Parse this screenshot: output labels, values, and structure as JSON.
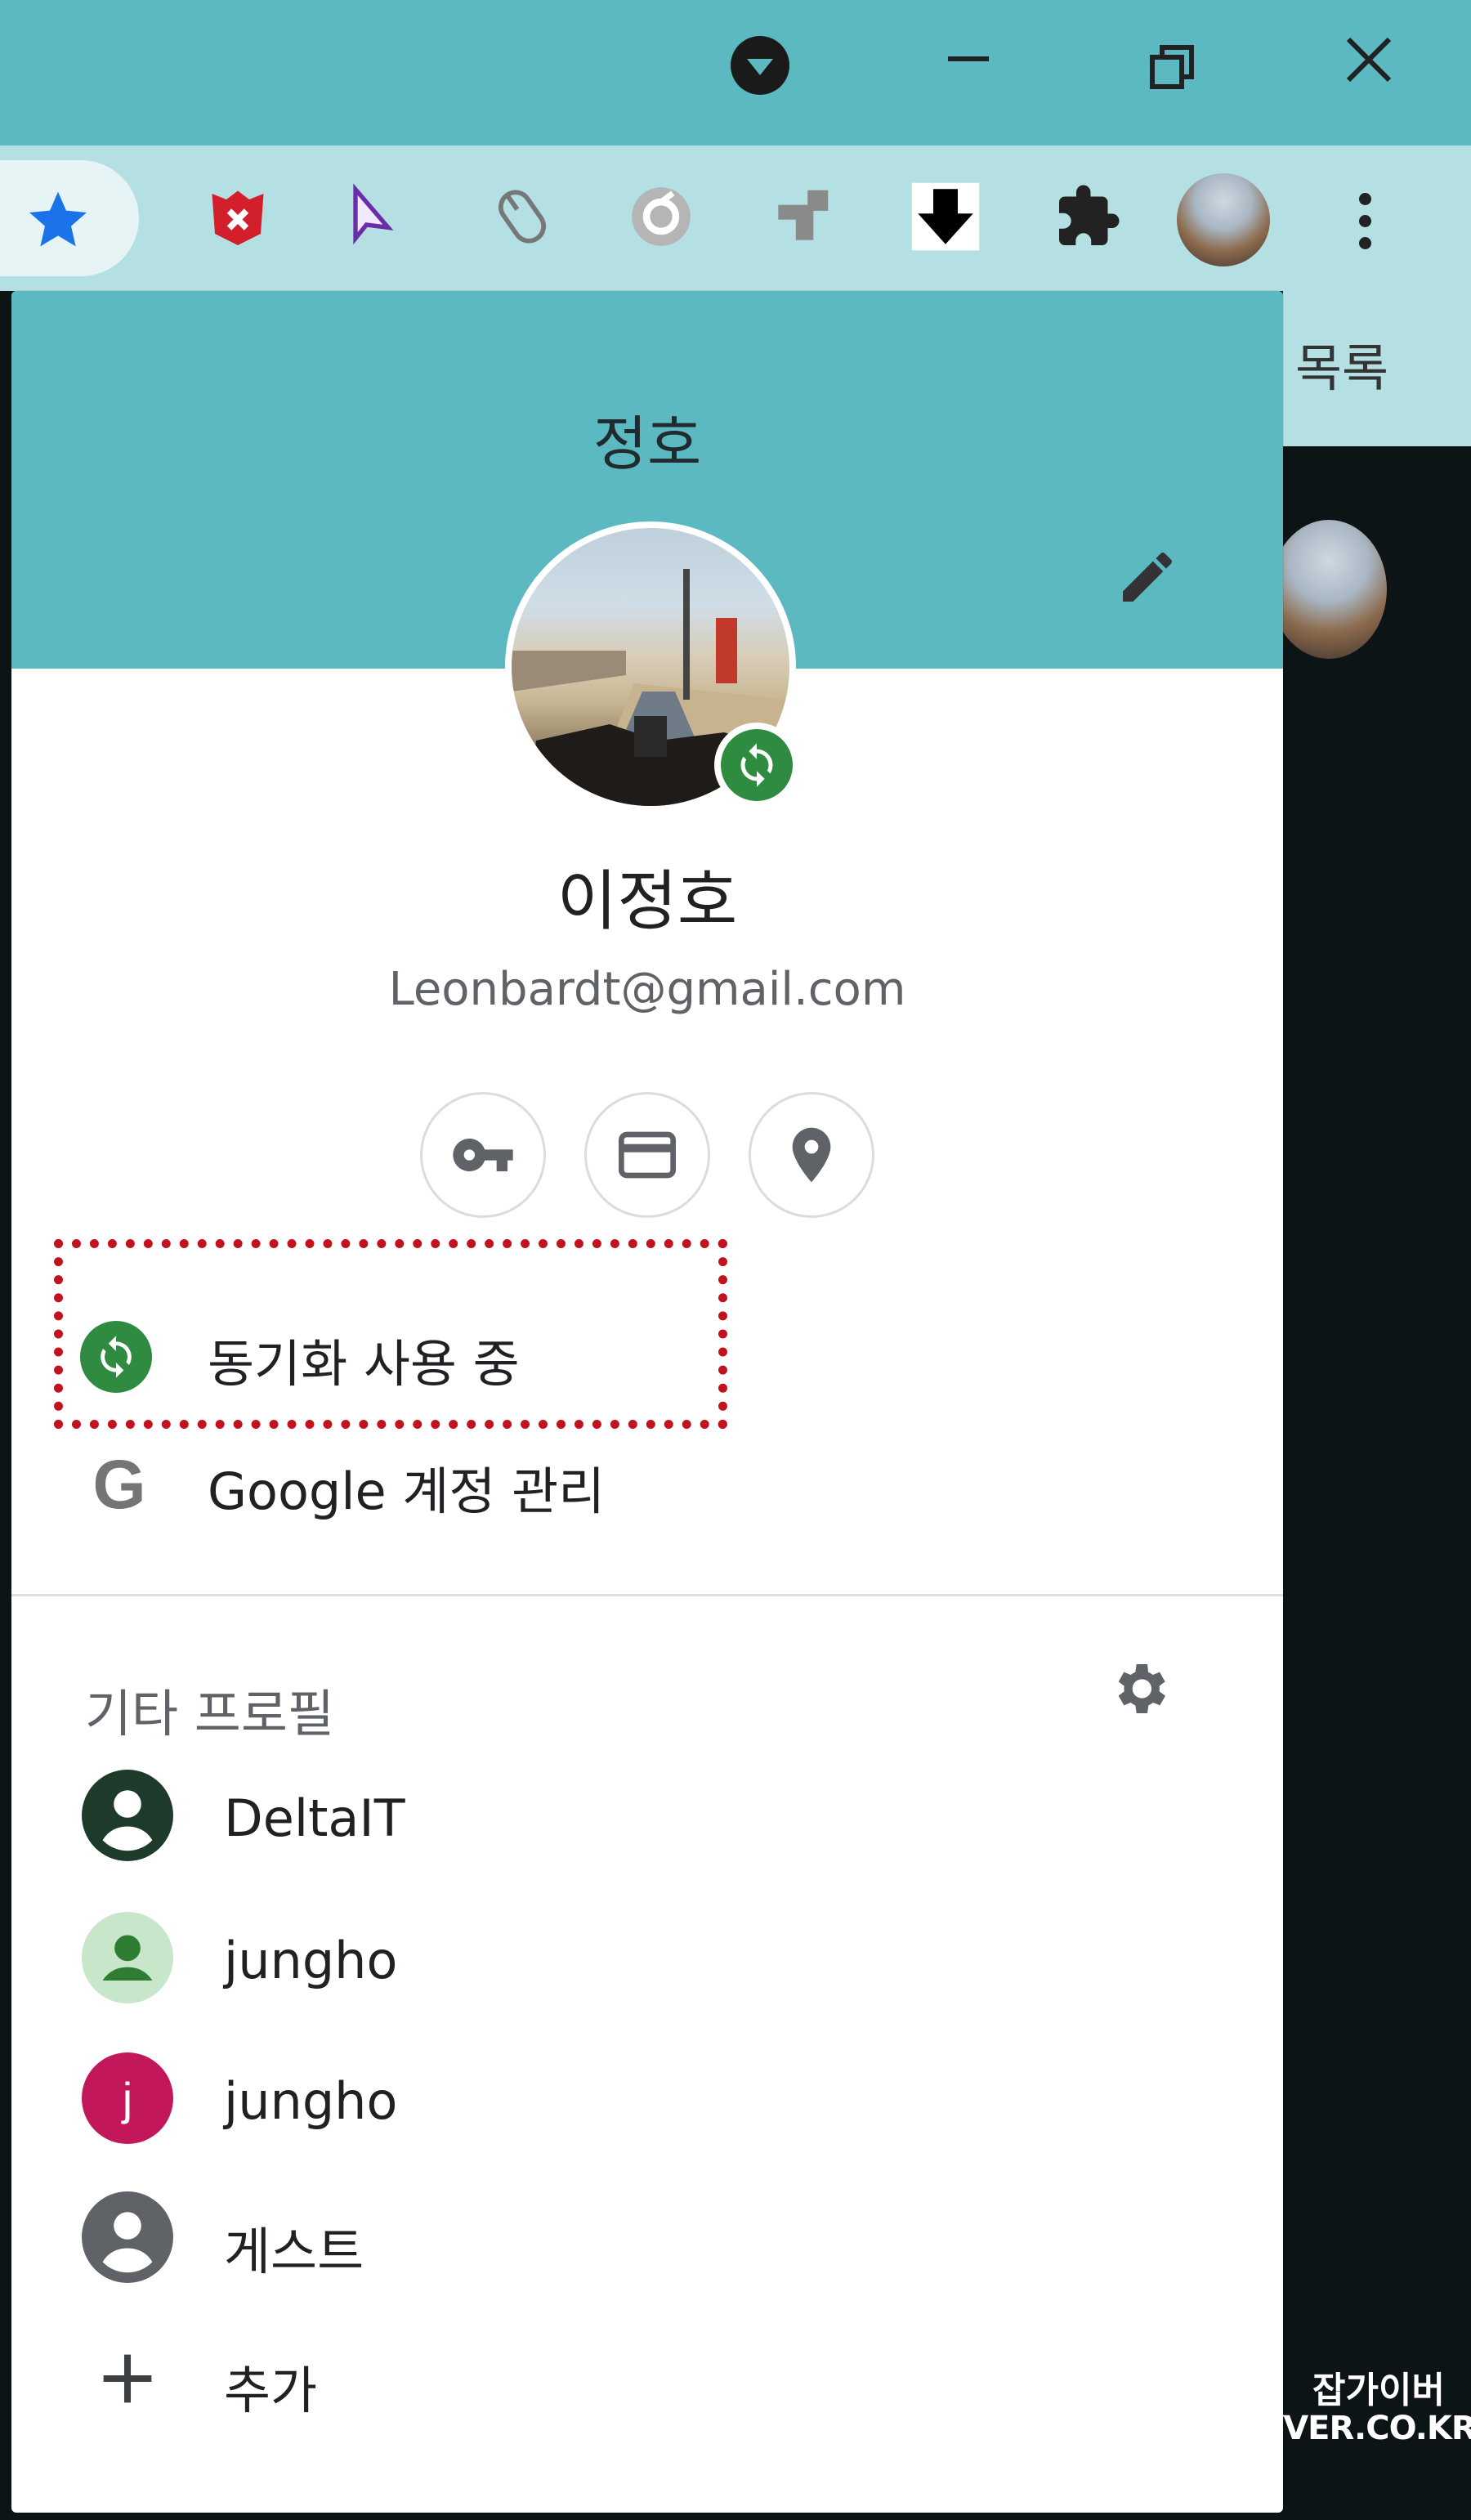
{
  "toolbar": {
    "bookmark_icon": "star-icon",
    "extensions": [
      "shield-x-extension-icon",
      "cursor-extension-icon",
      "mouse-extension-icon",
      "grey-circle-extension-icon",
      "grey-arrow-extension-icon",
      "download-extension-icon",
      "puzzle-icon"
    ],
    "menu_icon": "more-vert-icon"
  },
  "background_page": {
    "label": "목록"
  },
  "profile_menu": {
    "header_title": "정호",
    "user_name": "이정호",
    "email": "Leonbardt@gmail.com",
    "quick_actions": [
      "key-icon",
      "card-icon",
      "location-pin-icon"
    ],
    "sync_label": "동기화 사용 중",
    "manage_account_label": "Google 계정 관리",
    "other_profiles_title": "기타 프로필",
    "profiles": [
      {
        "name": "DeltaIT",
        "avatar_letter": "",
        "color": "#1e3a2a"
      },
      {
        "name": "jungho",
        "avatar_letter": "",
        "color": "#c8e6c9"
      },
      {
        "name": "jungho",
        "avatar_letter": "j",
        "color": "#c2185b"
      },
      {
        "name": "게스트",
        "avatar_letter": "",
        "color": "#5f6368"
      }
    ],
    "add_label": "추가"
  },
  "colors": {
    "accent": "#5cb8c1",
    "sync_green": "#2e8b3f",
    "highlight_red": "#c1121f"
  },
  "watermark": {
    "line1": "잡가이버",
    "line2": "JAB-GUYVER.CO.KR"
  }
}
